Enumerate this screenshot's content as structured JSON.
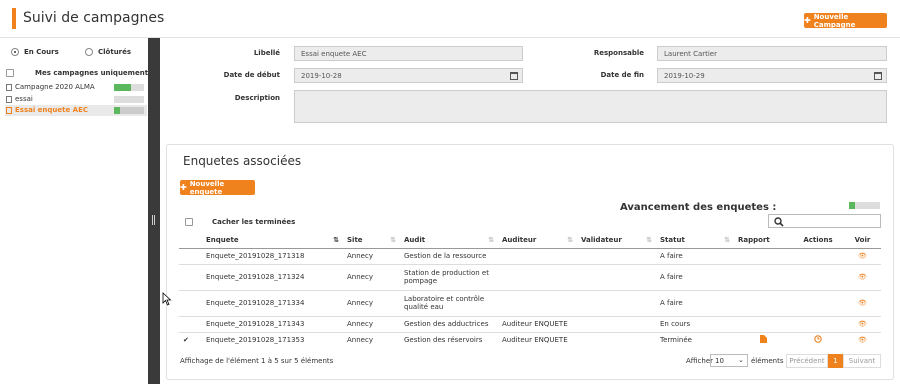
{
  "header": {
    "title": "Suivi de campagnes",
    "new_campaign": "Nouvelle Campagne"
  },
  "sidebar": {
    "filter_en_cours": "En Cours",
    "filter_clotures": "Clôturés",
    "mine_only": "Mes campagnes uniquement",
    "campaigns": [
      {
        "name": "Campagne 2020 ALMA",
        "progress": 0.55
      },
      {
        "name": "essai",
        "progress": 0.0
      },
      {
        "name": "Essai enquete AEC",
        "progress": 0.2
      }
    ]
  },
  "form": {
    "libelle_label": "Libellé",
    "libelle": "Essai enquete AEC",
    "responsable_label": "Responsable",
    "responsable": "Laurent Cartier",
    "debut_label": "Date de début",
    "debut": "2019-10-28",
    "fin_label": "Date de fin",
    "fin": "2019-10-29",
    "description_label": "Description",
    "description": ""
  },
  "panel": {
    "title": "Enquetes associées",
    "new_enquete": "Nouvelle enquete",
    "avancement": "Avancement des enquetes :",
    "avancement_progress": 0.2,
    "hide_done": "Cacher les terminées",
    "columns": [
      "Enquete",
      "Site",
      "Audit",
      "Auditeur",
      "Validateur",
      "Statut",
      "Rapport",
      "Actions",
      "Voir"
    ],
    "rows": [
      {
        "check": "",
        "enquete": "Enquete_20191028_171318",
        "site": "Annecy",
        "audit": "Gestion de la ressource",
        "auditeur": "",
        "validateur": "",
        "statut": "A faire"
      },
      {
        "check": "",
        "enquete": "Enquete_20191028_171324",
        "site": "Annecy",
        "audit": "Station de production et pompage",
        "auditeur": "",
        "validateur": "",
        "statut": "A faire"
      },
      {
        "check": "",
        "enquete": "Enquete_20191028_171334",
        "site": "Annecy",
        "audit": "Laboratoire et contrôle qualité eau",
        "auditeur": "",
        "validateur": "",
        "statut": "A faire"
      },
      {
        "check": "",
        "enquete": "Enquete_20191028_171343",
        "site": "Annecy",
        "audit": "Gestion des adductrices",
        "auditeur": "Auditeur ENQUETE",
        "validateur": "",
        "statut": "En cours"
      },
      {
        "check": "✔",
        "enquete": "Enquete_20191028_171353",
        "site": "Annecy",
        "audit": "Gestion des réservoirs",
        "auditeur": "Auditeur ENQUETE",
        "validateur": "",
        "statut": "Terminée"
      }
    ],
    "info": "Affichage de l'élément 1 à 5 sur 5 éléments",
    "afficher": "Afficher",
    "page_size": "10",
    "elements": "éléments",
    "prev": "Précédent",
    "page": "1",
    "next": "Suivant"
  },
  "colors": {
    "accent": "#f0821e",
    "progress": "#5cb85c",
    "divider": "#3a3a3a"
  },
  "icons": [
    "calendar-icon",
    "search-icon",
    "sort-icon",
    "file-icon",
    "clock-icon",
    "eye-icon",
    "checkmark-icon"
  ]
}
